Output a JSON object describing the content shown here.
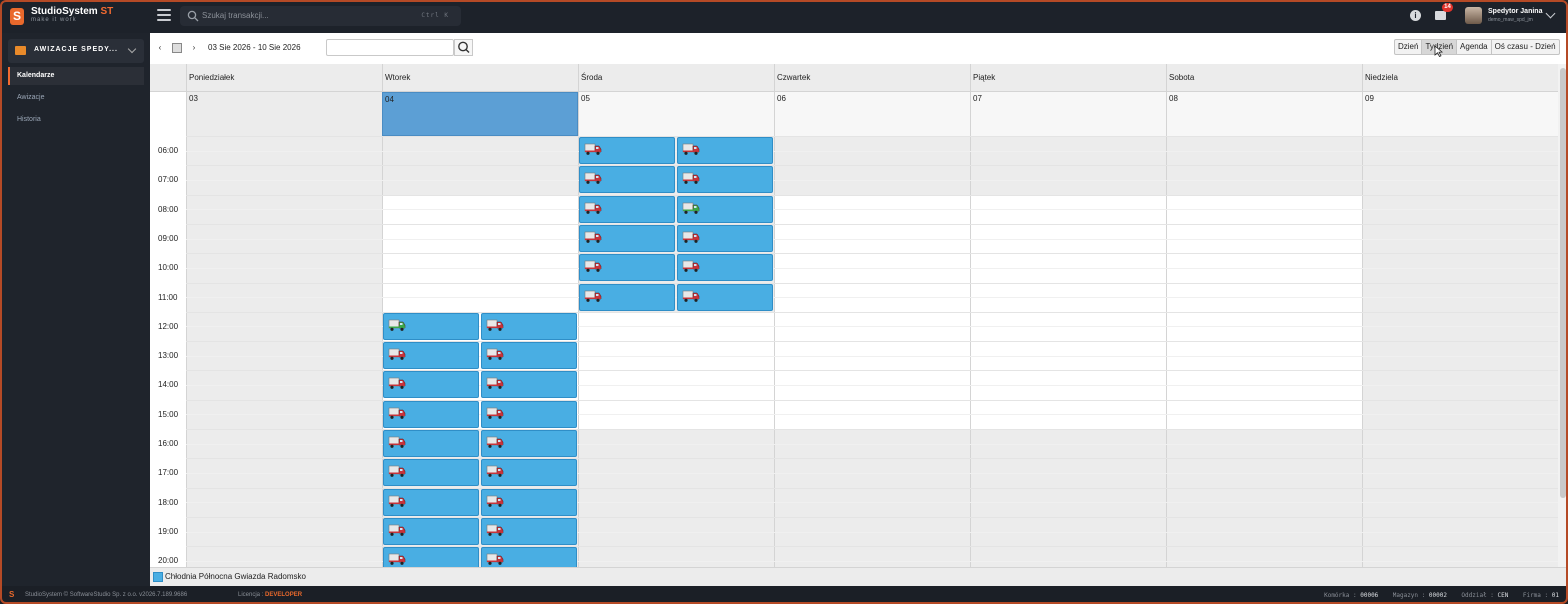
{
  "app": {
    "name": "StudioSystem",
    "name_accent": "ST",
    "tagline": "make it work",
    "brand_color": "#f36b31"
  },
  "search": {
    "placeholder": "Szukaj transakcji...",
    "shortcut": "Ctrl K",
    "icon": "search-icon"
  },
  "topbar": {
    "mail_count": "14",
    "user_name": "Spedytor Janina",
    "user_login": "demo_maw_spd_jm",
    "icons": [
      "menu-toggle-icon",
      "info-icon",
      "mail-icon",
      "chevron-down-icon"
    ]
  },
  "sidebar": {
    "module_label": "AWIZACJE SPEDY...",
    "items": [
      {
        "label": "Kalendarze",
        "active": true
      },
      {
        "label": "Awizacje",
        "active": false
      },
      {
        "label": "Historia",
        "active": false
      }
    ]
  },
  "toolbar": {
    "prev": "‹",
    "next": "›",
    "range": "03 Sie 2026 - 10 Sie 2026",
    "search_value": "",
    "views": [
      "Dzień",
      "Tydzień",
      "Agenda",
      "Oś czasu - Dzień"
    ],
    "active_view": "Tydzień"
  },
  "calendar": {
    "days": [
      {
        "name": "Poniedziałek",
        "date": "03"
      },
      {
        "name": "Wtorek",
        "date": "04"
      },
      {
        "name": "Środa",
        "date": "05"
      },
      {
        "name": "Czwartek",
        "date": "06"
      },
      {
        "name": "Piątek",
        "date": "07"
      },
      {
        "name": "Sobota",
        "date": "08"
      },
      {
        "name": "Niedziela",
        "date": "09"
      }
    ],
    "today_index": 1,
    "hours": [
      "06:00",
      "07:00",
      "08:00",
      "09:00",
      "10:00",
      "11:00",
      "12:00",
      "13:00",
      "14:00",
      "15:00",
      "16:00",
      "17:00",
      "18:00",
      "19:00",
      "20:00"
    ],
    "events": [
      {
        "day": 2,
        "hour": "06:00",
        "slot": 0,
        "truck": "red"
      },
      {
        "day": 2,
        "hour": "06:00",
        "slot": 1,
        "truck": "red"
      },
      {
        "day": 2,
        "hour": "07:00",
        "slot": 0,
        "truck": "red"
      },
      {
        "day": 2,
        "hour": "07:00",
        "slot": 1,
        "truck": "red"
      },
      {
        "day": 2,
        "hour": "08:00",
        "slot": 0,
        "truck": "red"
      },
      {
        "day": 2,
        "hour": "08:00",
        "slot": 1,
        "truck": "green"
      },
      {
        "day": 2,
        "hour": "09:00",
        "slot": 0,
        "truck": "red"
      },
      {
        "day": 2,
        "hour": "09:00",
        "slot": 1,
        "truck": "red"
      },
      {
        "day": 2,
        "hour": "10:00",
        "slot": 0,
        "truck": "red"
      },
      {
        "day": 2,
        "hour": "10:00",
        "slot": 1,
        "truck": "red"
      },
      {
        "day": 2,
        "hour": "11:00",
        "slot": 0,
        "truck": "red"
      },
      {
        "day": 2,
        "hour": "11:00",
        "slot": 1,
        "truck": "red"
      },
      {
        "day": 1,
        "hour": "12:00",
        "slot": 0,
        "truck": "green"
      },
      {
        "day": 1,
        "hour": "12:00",
        "slot": 1,
        "truck": "red"
      },
      {
        "day": 1,
        "hour": "13:00",
        "slot": 0,
        "truck": "red"
      },
      {
        "day": 1,
        "hour": "13:00",
        "slot": 1,
        "truck": "red"
      },
      {
        "day": 1,
        "hour": "14:00",
        "slot": 0,
        "truck": "red"
      },
      {
        "day": 1,
        "hour": "14:00",
        "slot": 1,
        "truck": "red"
      },
      {
        "day": 1,
        "hour": "15:00",
        "slot": 0,
        "truck": "red"
      },
      {
        "day": 1,
        "hour": "15:00",
        "slot": 1,
        "truck": "red"
      },
      {
        "day": 1,
        "hour": "16:00",
        "slot": 0,
        "truck": "red"
      },
      {
        "day": 1,
        "hour": "16:00",
        "slot": 1,
        "truck": "red"
      },
      {
        "day": 1,
        "hour": "17:00",
        "slot": 0,
        "truck": "red"
      },
      {
        "day": 1,
        "hour": "17:00",
        "slot": 1,
        "truck": "red"
      },
      {
        "day": 1,
        "hour": "18:00",
        "slot": 0,
        "truck": "red"
      },
      {
        "day": 1,
        "hour": "18:00",
        "slot": 1,
        "truck": "red"
      },
      {
        "day": 1,
        "hour": "19:00",
        "slot": 0,
        "truck": "red"
      },
      {
        "day": 1,
        "hour": "19:00",
        "slot": 1,
        "truck": "red"
      },
      {
        "day": 1,
        "hour": "20:00",
        "slot": 0,
        "truck": "red"
      },
      {
        "day": 1,
        "hour": "20:00",
        "slot": 1,
        "truck": "red"
      }
    ],
    "event_color": "#49aee3",
    "today_color": "#5c9fd5",
    "nonworking_color": "#ececec"
  },
  "legend": {
    "label": "Chłodnia Północna Gwiazda Radomsko",
    "color": "#49aee3"
  },
  "footer": {
    "copyright": "StudioSystem © SoftwareStudio Sp. z o.o.   v2026.7.189.9686",
    "license_label": "Licencja :",
    "license_value": "DEVELOPER",
    "komorka_label": "Komórka :",
    "komorka_value": "00006",
    "magazyn_label": "Magazyn :",
    "magazyn_value": "00002",
    "oddzial_label": "Oddział :",
    "oddzial_value": "CEN",
    "firma_label": "Firma :",
    "firma_value": "01"
  }
}
